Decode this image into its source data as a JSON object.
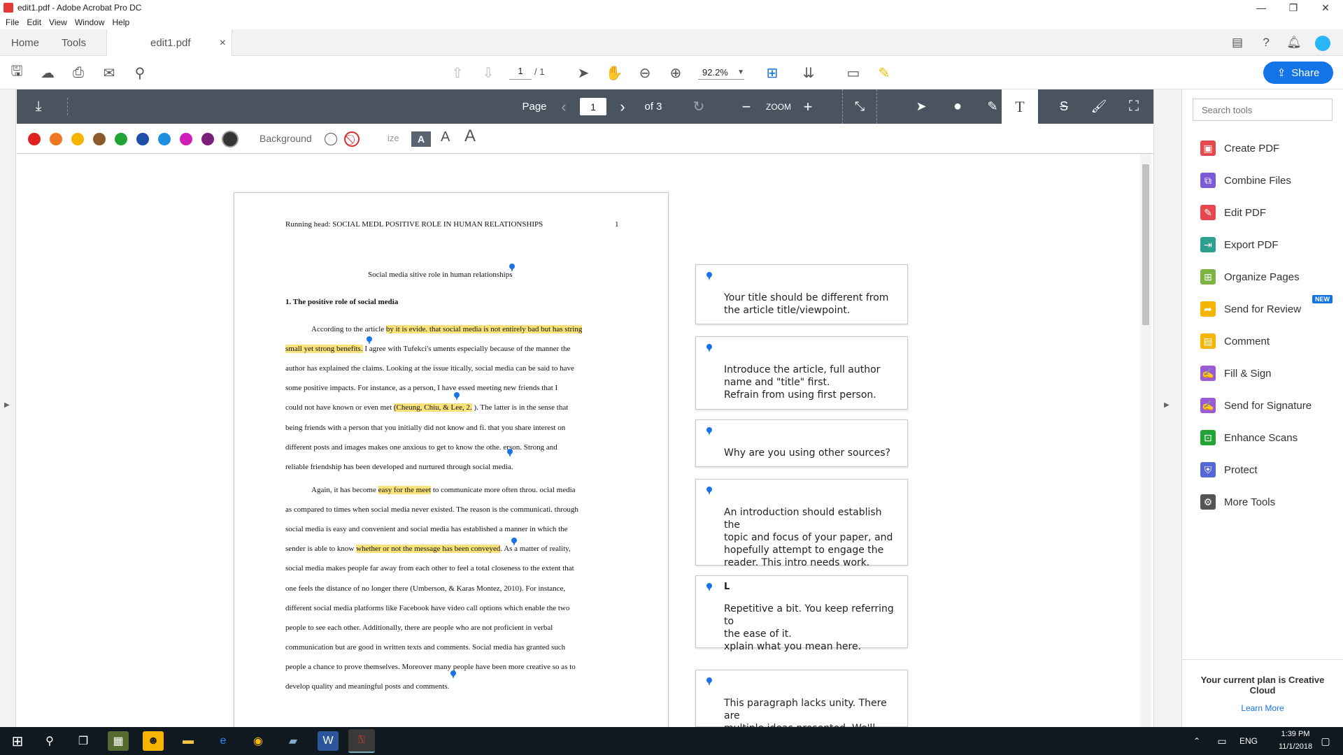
{
  "window": {
    "title": "edit1.pdf - Adobe Acrobat Pro DC",
    "minimize": "—",
    "maximize": "❐",
    "close": "✕"
  },
  "menu": [
    "File",
    "Edit",
    "View",
    "Window",
    "Help"
  ],
  "tabs": {
    "home": "Home",
    "tools": "Tools",
    "document": "edit1.pdf",
    "close": "×"
  },
  "toolbar": {
    "page_current": "1",
    "page_total": "/ 1",
    "zoom": "92.2%",
    "share": "Share"
  },
  "html_viewer_bar": {
    "page_label": "Page",
    "page_value": "1",
    "page_of": "of 3",
    "zoom_label": "ZOOM"
  },
  "color_bar": {
    "colors": [
      "#e02020",
      "#f07820",
      "#f4b400",
      "#8b5a2b",
      "#21a336",
      "#1f4fa8",
      "#1e90e0",
      "#d01fb8",
      "#7a1f7a",
      "#333333"
    ],
    "background_label": "Background",
    "size_label": "ize"
  },
  "document": {
    "running_head": "Running head: SOCIAL MEDL  POSITIVE ROLE IN HUMAN RELATIONSHIPS",
    "page_number": "1",
    "title": "Social media  sitive role in human relationships",
    "heading": "1.   The positive role of social media",
    "paragraph1": [
      {
        "pre": "According to the article ",
        "hl": "by it is evide.   that social media is not entirely bad but has string",
        "post": ""
      },
      {
        "pre": "",
        "hl": "small yet strong benefits.",
        "post": " I agree with Tufekci's   uments especially because of the manner the"
      },
      {
        "pre": "author has explained the claims. Looking at the issue   itically, social media can be said to have",
        "hl": "",
        "post": ""
      },
      {
        "pre": "some positive impacts. For instance, as a person, I have   essed meeting new friends that I",
        "hl": "",
        "post": ""
      },
      {
        "pre": "could not have known or even met ",
        "hl": "(Cheung, Chiu, & Lee, 2.",
        "post": "  ). The latter is in the sense that"
      },
      {
        "pre": "being friends with a person that you initially did not know and fi.   that you share interest on",
        "hl": "",
        "post": ""
      },
      {
        "pre": "different posts and images makes one anxious to get to know the othe.   erson. Strong and",
        "hl": "",
        "post": ""
      },
      {
        "pre": "reliable friendship has been developed and nurtured through social media.",
        "hl": "",
        "post": ""
      }
    ],
    "paragraph2": [
      {
        "pre": "Again, it has become ",
        "hl": "easy for the meet",
        "post": " to communicate more often throu.   ocial media"
      },
      {
        "pre": "as compared to times when social media never existed. The reason is the communicati.   through",
        "hl": "",
        "post": ""
      },
      {
        "pre": "social media is easy and convenient and social media has established a manner in which the",
        "hl": "",
        "post": ""
      },
      {
        "pre": "sender is able to know ",
        "hl": "whether or not the message has been conveyed",
        "post": ". As a matter of reality,"
      },
      {
        "pre": "social media makes people far away from each other to feel a total closeness to the extent that",
        "hl": "",
        "post": ""
      },
      {
        "pre": "one feels the distance of no longer there (Umberson, & Karas Montez, 2010). For instance,",
        "hl": "",
        "post": ""
      },
      {
        "pre": "different social media platforms like Facebook have video call options which enable the two",
        "hl": "",
        "post": ""
      },
      {
        "pre": "people to see each other. Additionally, there are people who are not proficient in verbal",
        "hl": "",
        "post": ""
      },
      {
        "pre": "communication but are good in written texts and comments. Social media has granted such",
        "hl": "",
        "post": ""
      },
      {
        "pre": "people a chance to prove themselves. Moreover many people have been more creative so as to",
        "hl": "",
        "post": ""
      },
      {
        "pre": "develop quality and meaningful posts and comments.",
        "hl": "",
        "post": ""
      }
    ]
  },
  "comments": [
    {
      "author": "",
      "lines": [
        "Your title should be different from",
        "the article title/viewpoint."
      ]
    },
    {
      "author": "",
      "lines": [
        "Introduce the article, full author",
        "name and \"title\" first.",
        "Refrain from using first person."
      ]
    },
    {
      "author": "",
      "lines": [
        "Why are you using other sources?"
      ]
    },
    {
      "author": "",
      "lines": [
        "An introduction should establish the",
        "topic and focus of your paper, and",
        "hopefully attempt to engage the",
        "reader. This intro needs work."
      ]
    },
    {
      "author": "L",
      "lines": [
        "Repetitive a bit. You keep referring to",
        "the ease of it.",
        "  xplain what you mean here."
      ]
    },
    {
      "author": "",
      "lines": [
        "This paragraph lacks unity. There are",
        "multiple ideas presented. We'll"
      ]
    }
  ],
  "right_pane": {
    "search_placeholder": "Search tools",
    "tools": [
      {
        "label": "Create PDF",
        "icon": "create-pdf-icon",
        "color": "#e5484d"
      },
      {
        "label": "Combine Files",
        "icon": "combine-files-icon",
        "color": "#7b5bd6"
      },
      {
        "label": "Edit PDF",
        "icon": "edit-pdf-icon",
        "color": "#e5484d"
      },
      {
        "label": "Export PDF",
        "icon": "export-pdf-icon",
        "color": "#2e9e8f"
      },
      {
        "label": "Organize Pages",
        "icon": "organize-pages-icon",
        "color": "#7cb342"
      },
      {
        "label": "Send for Review",
        "icon": "send-review-icon",
        "color": "#f4b400",
        "badge": "NEW"
      },
      {
        "label": "Comment",
        "icon": "comment-icon",
        "color": "#f4b400"
      },
      {
        "label": "Fill & Sign",
        "icon": "fill-sign-icon",
        "color": "#9c5bd6"
      },
      {
        "label": "Send for Signature",
        "icon": "send-signature-icon",
        "color": "#9c5bd6"
      },
      {
        "label": "Enhance Scans",
        "icon": "enhance-scans-icon",
        "color": "#21a336"
      },
      {
        "label": "Protect",
        "icon": "protect-icon",
        "color": "#5468d4"
      },
      {
        "label": "More Tools",
        "icon": "more-tools-icon",
        "color": "#555555"
      }
    ],
    "plan_text": "Your current plan is Creative Cloud",
    "learn_more": "Learn More"
  },
  "taskbar": {
    "lang": "ENG",
    "time": "1:39 PM",
    "date": "11/1/2018"
  }
}
